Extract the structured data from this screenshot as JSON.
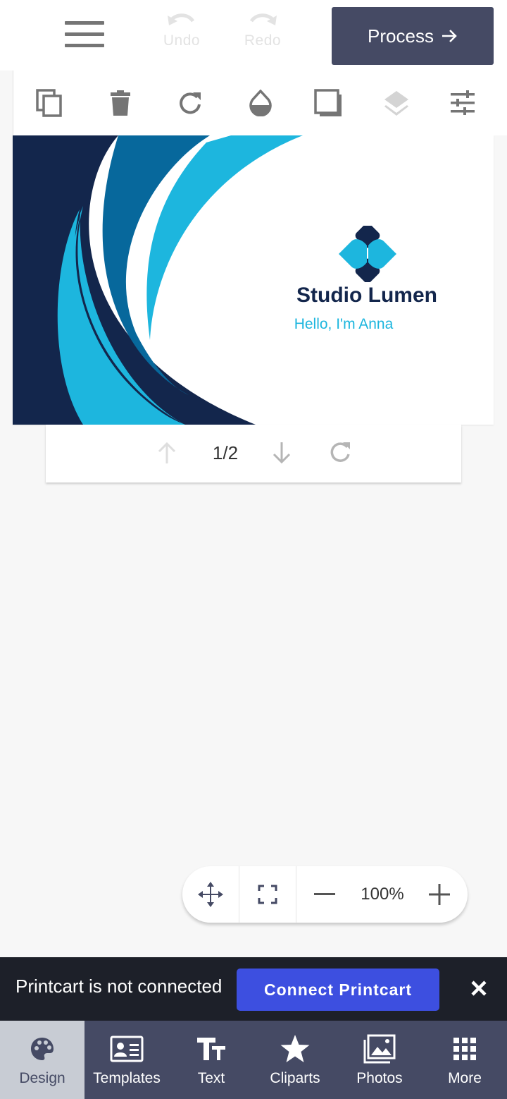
{
  "header": {
    "menu_icon": "hamburger-menu-icon",
    "undo_label": "Undo",
    "redo_label": "Redo",
    "process_label": "Process",
    "process_color": "#454a64"
  },
  "toolbar": {
    "tools": [
      "copy-icon",
      "delete-icon",
      "rotate-icon",
      "opacity-icon",
      "shadow-icon",
      "layers-icon",
      "adjust-icon"
    ]
  },
  "canvas": {
    "company_name": "Studio Lumen",
    "tagline": "Hello, I'm Anna",
    "colors": {
      "navy": "#13264c",
      "cyan": "#1db6de",
      "blue": "#07689c"
    }
  },
  "pager": {
    "page_indicator": "1/2"
  },
  "zoom": {
    "level": "100%"
  },
  "notification": {
    "message": "Printcart is not connected",
    "connect_label": "Connect Printcart",
    "connect_color": "#3d4fe0"
  },
  "bottom_nav": {
    "items": [
      {
        "label": "Design",
        "icon": "palette-icon",
        "active": true
      },
      {
        "label": "Templates",
        "icon": "id-card-icon",
        "active": false
      },
      {
        "label": "Text",
        "icon": "text-icon",
        "active": false
      },
      {
        "label": "Cliparts",
        "icon": "star-icon",
        "active": false
      },
      {
        "label": "Photos",
        "icon": "photo-icon",
        "active": false
      },
      {
        "label": "More",
        "icon": "grid-icon",
        "active": false
      }
    ]
  }
}
